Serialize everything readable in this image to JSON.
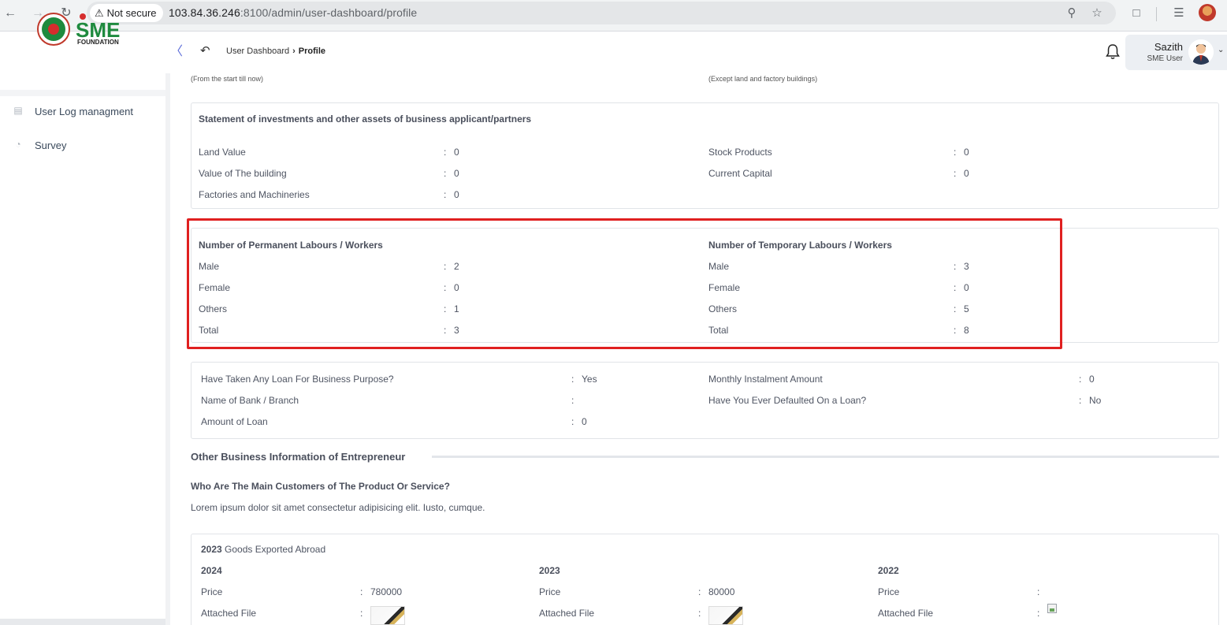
{
  "browser": {
    "security_label": "Not secure",
    "url_host": "103.84.36.246",
    "url_rest": ":8100/admin/user-dashboard/profile"
  },
  "header": {
    "logo_text": "SME",
    "logo_sub": "FOUNDATION",
    "breadcrumb": [
      "User Dashboard",
      "Profile"
    ],
    "user_name": "Sazith",
    "user_role": "SME User"
  },
  "sidebar": {
    "items": [
      {
        "label": "User Log managment",
        "icon": "log-icon"
      },
      {
        "label": "Survey",
        "icon": "pie-chart-icon"
      }
    ]
  },
  "notes": {
    "left": "(From the start till now)",
    "right": "(Except land and factory buildings)"
  },
  "investments": {
    "title": "Statement of investments and other assets of business applicant/partners",
    "left": [
      {
        "label": "Land Value",
        "value": "0"
      },
      {
        "label": "Value of The building",
        "value": "0"
      },
      {
        "label": "Factories and Machineries",
        "value": "0"
      }
    ],
    "right": [
      {
        "label": "Stock Products",
        "value": "0"
      },
      {
        "label": "Current Capital",
        "value": "0"
      }
    ]
  },
  "labours": {
    "permanent_title": "Number of Permanent Labours / Workers",
    "temporary_title": "Number of Temporary Labours / Workers",
    "permanent": [
      {
        "label": "Male",
        "value": "2"
      },
      {
        "label": "Female",
        "value": "0"
      },
      {
        "label": "Others",
        "value": "1"
      },
      {
        "label": "Total",
        "value": "3"
      }
    ],
    "temporary": [
      {
        "label": "Male",
        "value": "3"
      },
      {
        "label": "Female",
        "value": "0"
      },
      {
        "label": "Others",
        "value": "5"
      },
      {
        "label": "Total",
        "value": "8"
      }
    ]
  },
  "loan": {
    "left": [
      {
        "label": "Have Taken Any Loan For Business Purpose?",
        "value": "Yes"
      },
      {
        "label": "Name of Bank / Branch",
        "value": ""
      },
      {
        "label": "Amount of Loan",
        "value": "0"
      }
    ],
    "right": [
      {
        "label": "Monthly Instalment Amount",
        "value": "0"
      },
      {
        "label": "Have You Ever Defaulted On a Loan?",
        "value": "No"
      }
    ]
  },
  "other_info": {
    "section_title": "Other Business Information of Entrepreneur",
    "question": "Who Are The Main Customers of The Product Or Service?",
    "answer": "Lorem ipsum dolor sit amet consectetur adipisicing elit. Iusto, cumque."
  },
  "exports": {
    "heading_year": "2023",
    "heading_text": "Goods Exported Abroad",
    "price_label": "Price",
    "file_label": "Attached File",
    "years": [
      {
        "year": "2024",
        "price": "780000"
      },
      {
        "year": "2023",
        "price": "80000"
      },
      {
        "year": "2022",
        "price": ""
      }
    ]
  }
}
